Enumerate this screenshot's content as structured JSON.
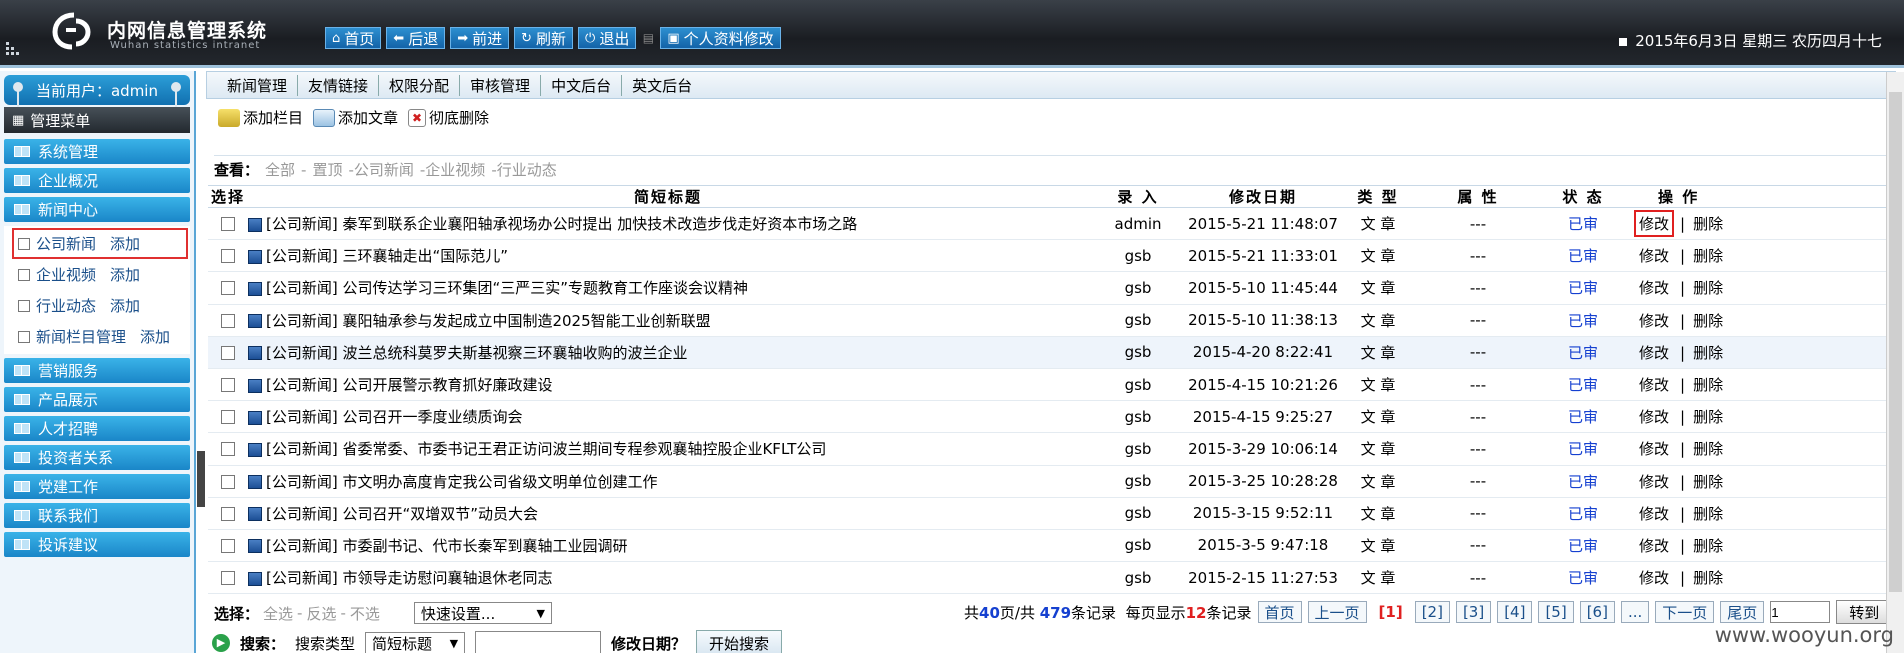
{
  "app": {
    "title": "内网信息管理系统",
    "subtitle": "Wuhan statistics intranet",
    "date": "2015年6月3日  星期三  农历四月十七"
  },
  "topnav": {
    "home": "首页",
    "back": "后退",
    "forward": "前进",
    "refresh": "刷新",
    "logout": "退出",
    "profile": "个人资料修改"
  },
  "sidebar": {
    "current_user": "当前用户：admin",
    "menu_title": "管理菜单",
    "items_top": [
      "系统管理",
      "企业概况",
      "新闻中心"
    ],
    "news_sub": [
      {
        "label": "公司新闻",
        "add": "添加"
      },
      {
        "label": "企业视频",
        "add": "添加"
      },
      {
        "label": "行业动态",
        "add": "添加"
      },
      {
        "label": "新闻栏目管理",
        "add": "添加"
      }
    ],
    "items_bottom": [
      "营销服务",
      "产品展示",
      "人才招聘",
      "投资者关系",
      "党建工作",
      "联系我们",
      "投诉建议"
    ]
  },
  "tabs": [
    "新闻管理",
    "友情链接",
    "权限分配",
    "审核管理",
    "中文后台",
    "英文后台"
  ],
  "toolbar": {
    "add_column": "添加栏目",
    "add_article": "添加文章",
    "delete_all": "彻底删除"
  },
  "filter": {
    "label": "查看：",
    "options": [
      "全部",
      "-",
      "置顶",
      "-公司新闻",
      "-企业视频",
      "-行业动态"
    ]
  },
  "table": {
    "headers": {
      "select": "选择",
      "title": "简短标题",
      "author": "录 入",
      "date": "修改日期",
      "type": "类 型",
      "attr": "属 性",
      "status": "状 态",
      "ops": "操 作"
    },
    "rows": [
      {
        "title": "[公司新闻] 秦军到联系企业襄阳轴承视场办公时提出 加快技术改造步伐走好资本市场之路",
        "author": "admin",
        "date": "2015-5-21 11:48:07",
        "type": "文 章",
        "attr": "---",
        "status": "已审",
        "edit": "修改",
        "del": "删除"
      },
      {
        "title": "[公司新闻] 三环襄轴走出“国际范儿”",
        "author": "gsb",
        "date": "2015-5-21 11:33:01",
        "type": "文 章",
        "attr": "---",
        "status": "已审",
        "edit": "修改",
        "del": "删除"
      },
      {
        "title": "[公司新闻] 公司传达学习三环集团“三严三实”专题教育工作座谈会议精神",
        "author": "gsb",
        "date": "2015-5-10 11:45:44",
        "type": "文 章",
        "attr": "---",
        "status": "已审",
        "edit": "修改",
        "del": "删除"
      },
      {
        "title": "[公司新闻] 襄阳轴承参与发起成立中国制造2025智能工业创新联盟",
        "author": "gsb",
        "date": "2015-5-10 11:38:13",
        "type": "文 章",
        "attr": "---",
        "status": "已审",
        "edit": "修改",
        "del": "删除"
      },
      {
        "title": "[公司新闻] 波兰总统科莫罗夫斯基视察三环襄轴收购的波兰企业",
        "author": "gsb",
        "date": "2015-4-20 8:22:41",
        "type": "文 章",
        "attr": "---",
        "status": "已审",
        "edit": "修改",
        "del": "删除"
      },
      {
        "title": "[公司新闻] 公司开展警示教育抓好廉政建设",
        "author": "gsb",
        "date": "2015-4-15 10:21:26",
        "type": "文 章",
        "attr": "---",
        "status": "已审",
        "edit": "修改",
        "del": "删除"
      },
      {
        "title": "[公司新闻] 公司召开一季度业绩质询会",
        "author": "gsb",
        "date": "2015-4-15 9:25:27",
        "type": "文 章",
        "attr": "---",
        "status": "已审",
        "edit": "修改",
        "del": "删除"
      },
      {
        "title": "[公司新闻] 省委常委、市委书记王君正访问波兰期间专程参观襄轴控股企业KFLT公司",
        "author": "gsb",
        "date": "2015-3-29 10:06:14",
        "type": "文 章",
        "attr": "---",
        "status": "已审",
        "edit": "修改",
        "del": "删除"
      },
      {
        "title": "[公司新闻] 市文明办高度肯定我公司省级文明单位创建工作",
        "author": "gsb",
        "date": "2015-3-25 10:28:28",
        "type": "文 章",
        "attr": "---",
        "status": "已审",
        "edit": "修改",
        "del": "删除"
      },
      {
        "title": "[公司新闻] 公司召开“双增双节”动员大会",
        "author": "gsb",
        "date": "2015-3-15 9:52:11",
        "type": "文 章",
        "attr": "---",
        "status": "已审",
        "edit": "修改",
        "del": "删除"
      },
      {
        "title": "[公司新闻] 市委副书记、代市长秦军到襄轴工业园调研",
        "author": "gsb",
        "date": "2015-3-5 9:47:18",
        "type": "文 章",
        "attr": "---",
        "status": "已审",
        "edit": "修改",
        "del": "删除"
      },
      {
        "title": "[公司新闻] 市领导走访慰问襄轴退休老同志",
        "author": "gsb",
        "date": "2015-2-15 11:27:53",
        "type": "文 章",
        "attr": "---",
        "status": "已审",
        "edit": "修改",
        "del": "删除"
      }
    ]
  },
  "bottom": {
    "select_label": "选择：",
    "select_all": "全选",
    "invert": "反选",
    "none": "不选",
    "dash": "-",
    "quick_set": "快速设置...",
    "total_prefix": "共",
    "pages": "40",
    "pages_suffix": "页/共",
    "records": "479",
    "records_suffix": "条记录",
    "per_page_prefix": "每页显示",
    "per_page": "12",
    "per_page_suffix": "条记录",
    "first": "首页",
    "prev": "上一页",
    "current": "[1]",
    "page_links": [
      "[2]",
      "[3]",
      "[4]",
      "[5]",
      "[6]",
      "..."
    ],
    "next": "下一页",
    "last": "尾页",
    "goto_value": "1",
    "goto": "转到"
  },
  "search": {
    "label": "搜索：",
    "type_label": "搜索类型",
    "type_value": "简短标题",
    "date_label": "修改日期？",
    "button": "开始搜索"
  },
  "watermark": "www.wooyun.org"
}
